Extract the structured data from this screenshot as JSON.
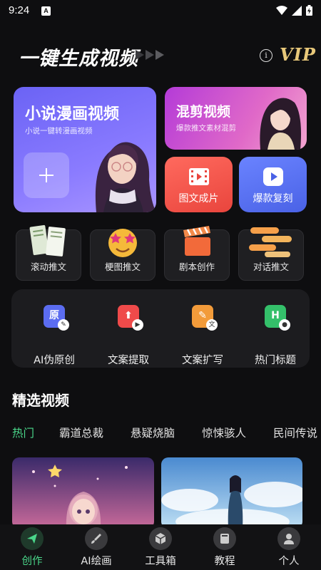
{
  "status_bar": {
    "time": "9:24",
    "notification_badge": "A"
  },
  "header": {
    "title": "一键生成视频",
    "vip_label": "VIP"
  },
  "cards": {
    "novel": {
      "title": "小说漫画视频",
      "subtitle": "小说一键转漫画视频"
    },
    "mix": {
      "title": "混剪视频",
      "subtitle": "爆款推文素材混剪"
    },
    "tuwen": {
      "label": "图文成片"
    },
    "baokuan": {
      "label": "爆款复刻"
    }
  },
  "templates": [
    {
      "label": "滚动推文",
      "icon": "scroll-text-icon"
    },
    {
      "label": "梗图推文",
      "icon": "star-eyes-emoji-icon"
    },
    {
      "label": "剧本创作",
      "icon": "clapperboard-icon"
    },
    {
      "label": "对话推文",
      "icon": "chat-bubbles-icon"
    }
  ],
  "tools": [
    {
      "label": "AI伪原创",
      "glyph": "原",
      "color": "#5b6cf0",
      "icon": "original-pen-icon"
    },
    {
      "label": "文案提取",
      "glyph": "⬆",
      "color": "#ef4a4a",
      "icon": "extract-icon"
    },
    {
      "label": "文案扩写",
      "glyph": "✎",
      "color": "#f29b3a",
      "icon": "expand-write-icon"
    },
    {
      "label": "热门标题",
      "glyph": "H",
      "color": "#34c06a",
      "icon": "hot-title-icon"
    }
  ],
  "section": {
    "title": "精选视频",
    "tabs": [
      "热门",
      "霸道总裁",
      "悬疑烧脑",
      "惊悚骇人",
      "民间传说"
    ],
    "active_tab": "热门"
  },
  "bottom_nav": [
    {
      "label": "创作",
      "icon": "paper-plane-icon",
      "active": true
    },
    {
      "label": "AI绘画",
      "icon": "brush-icon",
      "active": false
    },
    {
      "label": "工具箱",
      "icon": "box-icon",
      "active": false
    },
    {
      "label": "教程",
      "icon": "book-icon",
      "active": false
    },
    {
      "label": "个人",
      "icon": "person-icon",
      "active": false
    }
  ],
  "colors": {
    "accent_green": "#4ad78a",
    "background": "#0e0e10"
  }
}
